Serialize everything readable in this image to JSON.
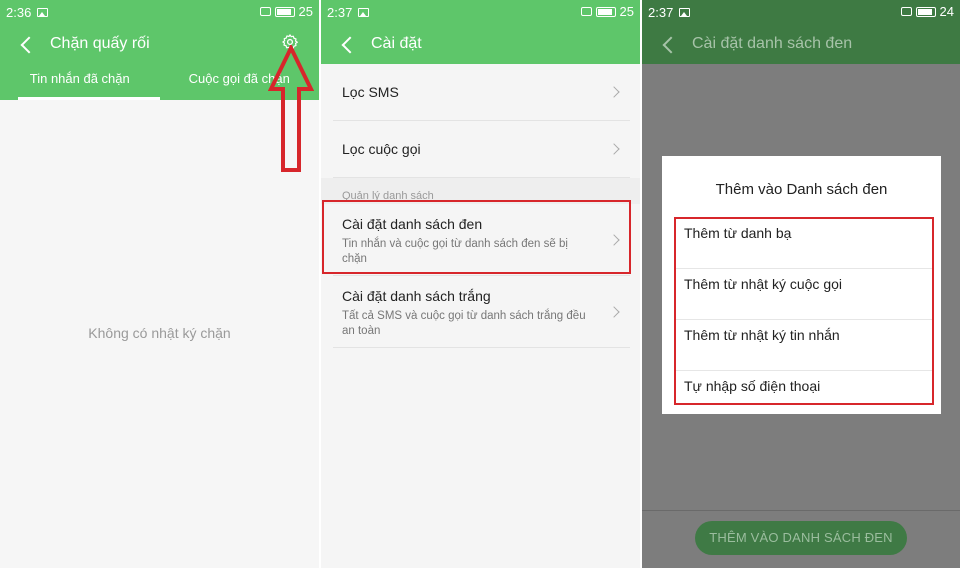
{
  "panel1": {
    "status": {
      "time": "2:36",
      "battery": "25"
    },
    "title": "Chặn quấy rối",
    "tabs": [
      "Tin nhắn đã chặn",
      "Cuộc gọi đã chặn"
    ],
    "empty_message": "Không có nhật ký chặn"
  },
  "panel2": {
    "status": {
      "time": "2:37",
      "battery": "25"
    },
    "title": "Cài đặt",
    "items": [
      {
        "label": "Lọc SMS"
      },
      {
        "label": "Lọc cuộc gọi"
      }
    ],
    "section_header": "Quản lý danh sách",
    "blacklist": {
      "label": "Cài đặt danh sách đen",
      "sub": "Tin nhắn và cuộc gọi từ danh sách đen sẽ bị chặn"
    },
    "whitelist": {
      "label": "Cài đặt danh sách trắng",
      "sub": "Tất cả SMS và cuộc gọi từ danh sách trắng đều an toàn"
    }
  },
  "panel3": {
    "status": {
      "time": "2:37",
      "battery": "24"
    },
    "title": "Cài đặt danh sách đen",
    "dialog": {
      "title": "Thêm vào Danh sách đen",
      "options": [
        "Thêm từ danh bạ",
        "Thêm từ nhật ký cuộc gọi",
        "Thêm từ nhật ký tin nhắn",
        "Tự nhập số điện thoại"
      ]
    },
    "button_label": "THÊM VÀO DANH SÁCH ĐEN"
  },
  "colors": {
    "accent": "#5ec66a",
    "dimmed_accent": "#3e7a43",
    "highlight": "#d7262b"
  }
}
